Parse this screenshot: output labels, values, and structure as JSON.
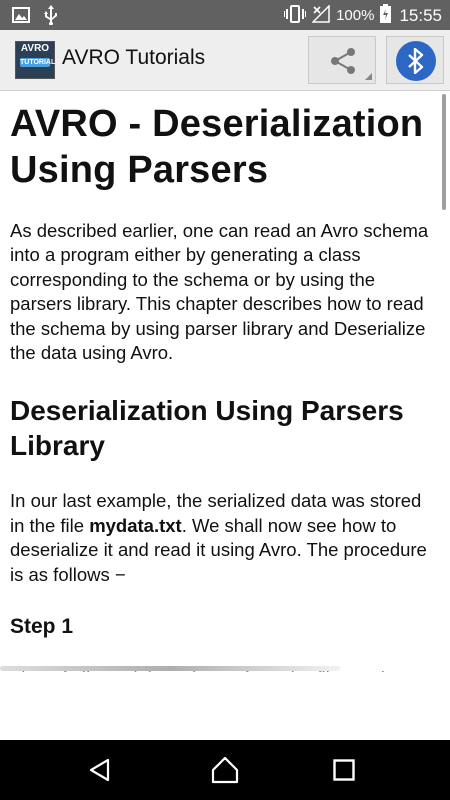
{
  "status_bar": {
    "icons_left": [
      "image-icon",
      "usb-icon"
    ],
    "battery": "100%",
    "time": "15:55"
  },
  "app_bar": {
    "logo_text": "AVRO",
    "logo_subtext": "TUTORIAL",
    "title": "AVRO Tutorials",
    "share_icon": "share-icon",
    "bluetooth_icon": "bluetooth-icon",
    "bluetooth_color": "#2d67c6"
  },
  "article": {
    "h1": "AVRO - Deserialization Using Parsers",
    "intro": "As described earlier, one can read an Avro schema into a program either by generating a class corresponding to the schema or by using the parsers library. This chapter describes how to read the schema by using parser library and Deserialize the data using Avro.",
    "h2": "Deserialization Using Parsers Library",
    "para2_before": "In our last example, the serialized data was stored in the file ",
    "para2_bold": "mydata.txt",
    "para2_after": ". We shall now see how to deserialize it and read it using Avro. The procedure is as follows −",
    "step_heading": "Step 1",
    "step1_text": "First of all, read the schema from the file. To do"
  },
  "nav_bar": {
    "back_icon": "back-icon",
    "home_icon": "home-icon",
    "recents_icon": "recents-icon"
  }
}
